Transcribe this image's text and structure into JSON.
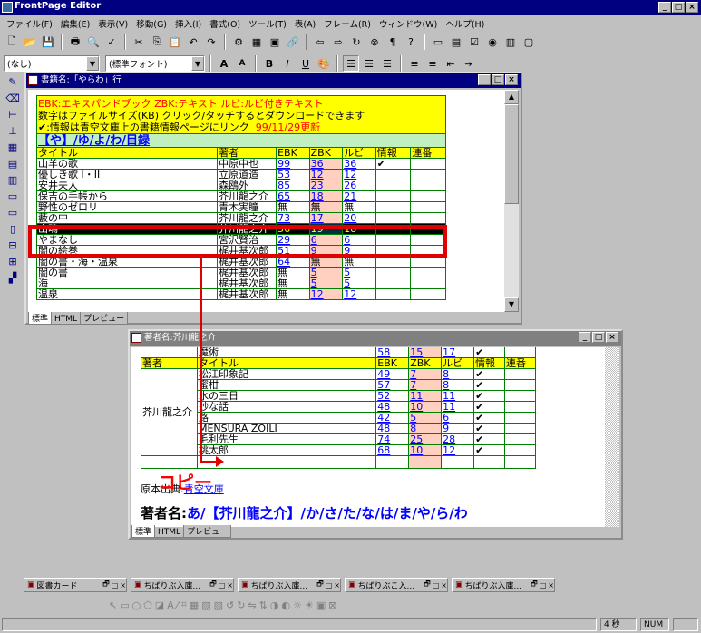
{
  "app": {
    "title": "FrontPage Editor"
  },
  "menu": [
    "ファイル(F)",
    "編集(E)",
    "表示(V)",
    "移動(G)",
    "挿入(I)",
    "書式(O)",
    "ツール(T)",
    "表(A)",
    "フレーム(R)",
    "ウィンドウ(W)",
    "ヘルプ(H)"
  ],
  "format_bar": {
    "style": "(なし)",
    "font": "(標準フォント)"
  },
  "win1": {
    "title": "書籍名:「やらわ」行",
    "info1": "EBK:エキスパンドブック ZBK:テキスト ルビ:ルビ付きテキスト",
    "info2": "数字はファイルサイズ(KB) クリック/タッチするとダウンロードできます",
    "info3": ":情報は青空文庫上の書籍情報ページにリンク",
    "updated": "99/11/29更新",
    "nav": "【や】/ゆ/よ/わ/目録",
    "headers": [
      "タイトル",
      "著者",
      "EBK",
      "ZBK",
      "ルビ",
      "情報",
      "連番"
    ],
    "rows": [
      [
        "山羊の歌",
        "中原中也",
        "99",
        "36",
        "36"
      ],
      [
        "優しき歌 I・II",
        "立原道造",
        "53",
        "12",
        "12"
      ],
      [
        "安井夫人",
        "森鴎外",
        "85",
        "23",
        "26"
      ],
      [
        "保吉の手帳から",
        "芥川龍之介",
        "65",
        "18",
        "21"
      ],
      [
        "野性のゼロリ",
        "青木実瞳",
        "無",
        "無",
        "無"
      ],
      [
        "藪の中",
        "芥川龍之介",
        "73",
        "17",
        "20"
      ],
      [
        "山鴫",
        "芥川龍之介",
        "56",
        "19",
        "18"
      ],
      [
        "やまなし",
        "宮沢賢治",
        "29",
        "6",
        "6"
      ],
      [
        "闇の絵巻",
        "梶井基次郎",
        "51",
        "9",
        "9"
      ],
      [
        "闇の書・海・温泉",
        "梶井基次郎",
        "64",
        "無",
        "無"
      ],
      [
        "闇の書",
        "梶井基次郎",
        "無",
        "5",
        "5"
      ],
      [
        "海",
        "梶井基次郎",
        "無",
        "5",
        "5"
      ],
      [
        "温泉",
        "梶井基次郎",
        "無",
        "12",
        "12"
      ]
    ],
    "tabs": [
      "標準",
      "HTML",
      "プレビュー"
    ]
  },
  "win2": {
    "title": "著者名:芥川龍之介",
    "top_row": [
      "魔術",
      "58",
      "15",
      "17"
    ],
    "headers": [
      "著者",
      "タイトル",
      "EBK",
      "ZBK",
      "ルビ",
      "情報",
      "連番"
    ],
    "author": "芥川龍之介",
    "rows": [
      [
        "松江印象記",
        "49",
        "7",
        "8"
      ],
      [
        "蜜柑",
        "57",
        "7",
        "8"
      ],
      [
        "水の三日",
        "52",
        "11",
        "11"
      ],
      [
        "妙な話",
        "48",
        "10",
        "11"
      ],
      [
        "路",
        "42",
        "5",
        "6"
      ],
      [
        "MENSURA ZOILI",
        "48",
        "8",
        "9"
      ],
      [
        "毛利先生",
        "74",
        "25",
        "28"
      ],
      [
        "桃太郎",
        "68",
        "10",
        "12"
      ]
    ],
    "copy_label": "コピー",
    "source_label": "原本出典:",
    "source_link": "青空文庫",
    "author_line_prefix": "著者名:",
    "author_line_rest": "あ/【芥川龍之介】/か/さ/た/な/は/ま/や/ら/わ",
    "tabs": [
      "標準",
      "HTML",
      "プレビュー"
    ]
  },
  "taskbar": [
    "図書カード",
    "ちばりぶ入庫...",
    "ちばりぶ入庫...",
    "ちばりぶこ入...",
    "ちばりぶ入庫..."
  ],
  "status": {
    "time": "4 秒",
    "mode": "NUM"
  },
  "colors": {
    "title_bg": "#000080",
    "highlight": "#e00000",
    "table_border": "#008000",
    "header_yellow": "#ffff00"
  }
}
